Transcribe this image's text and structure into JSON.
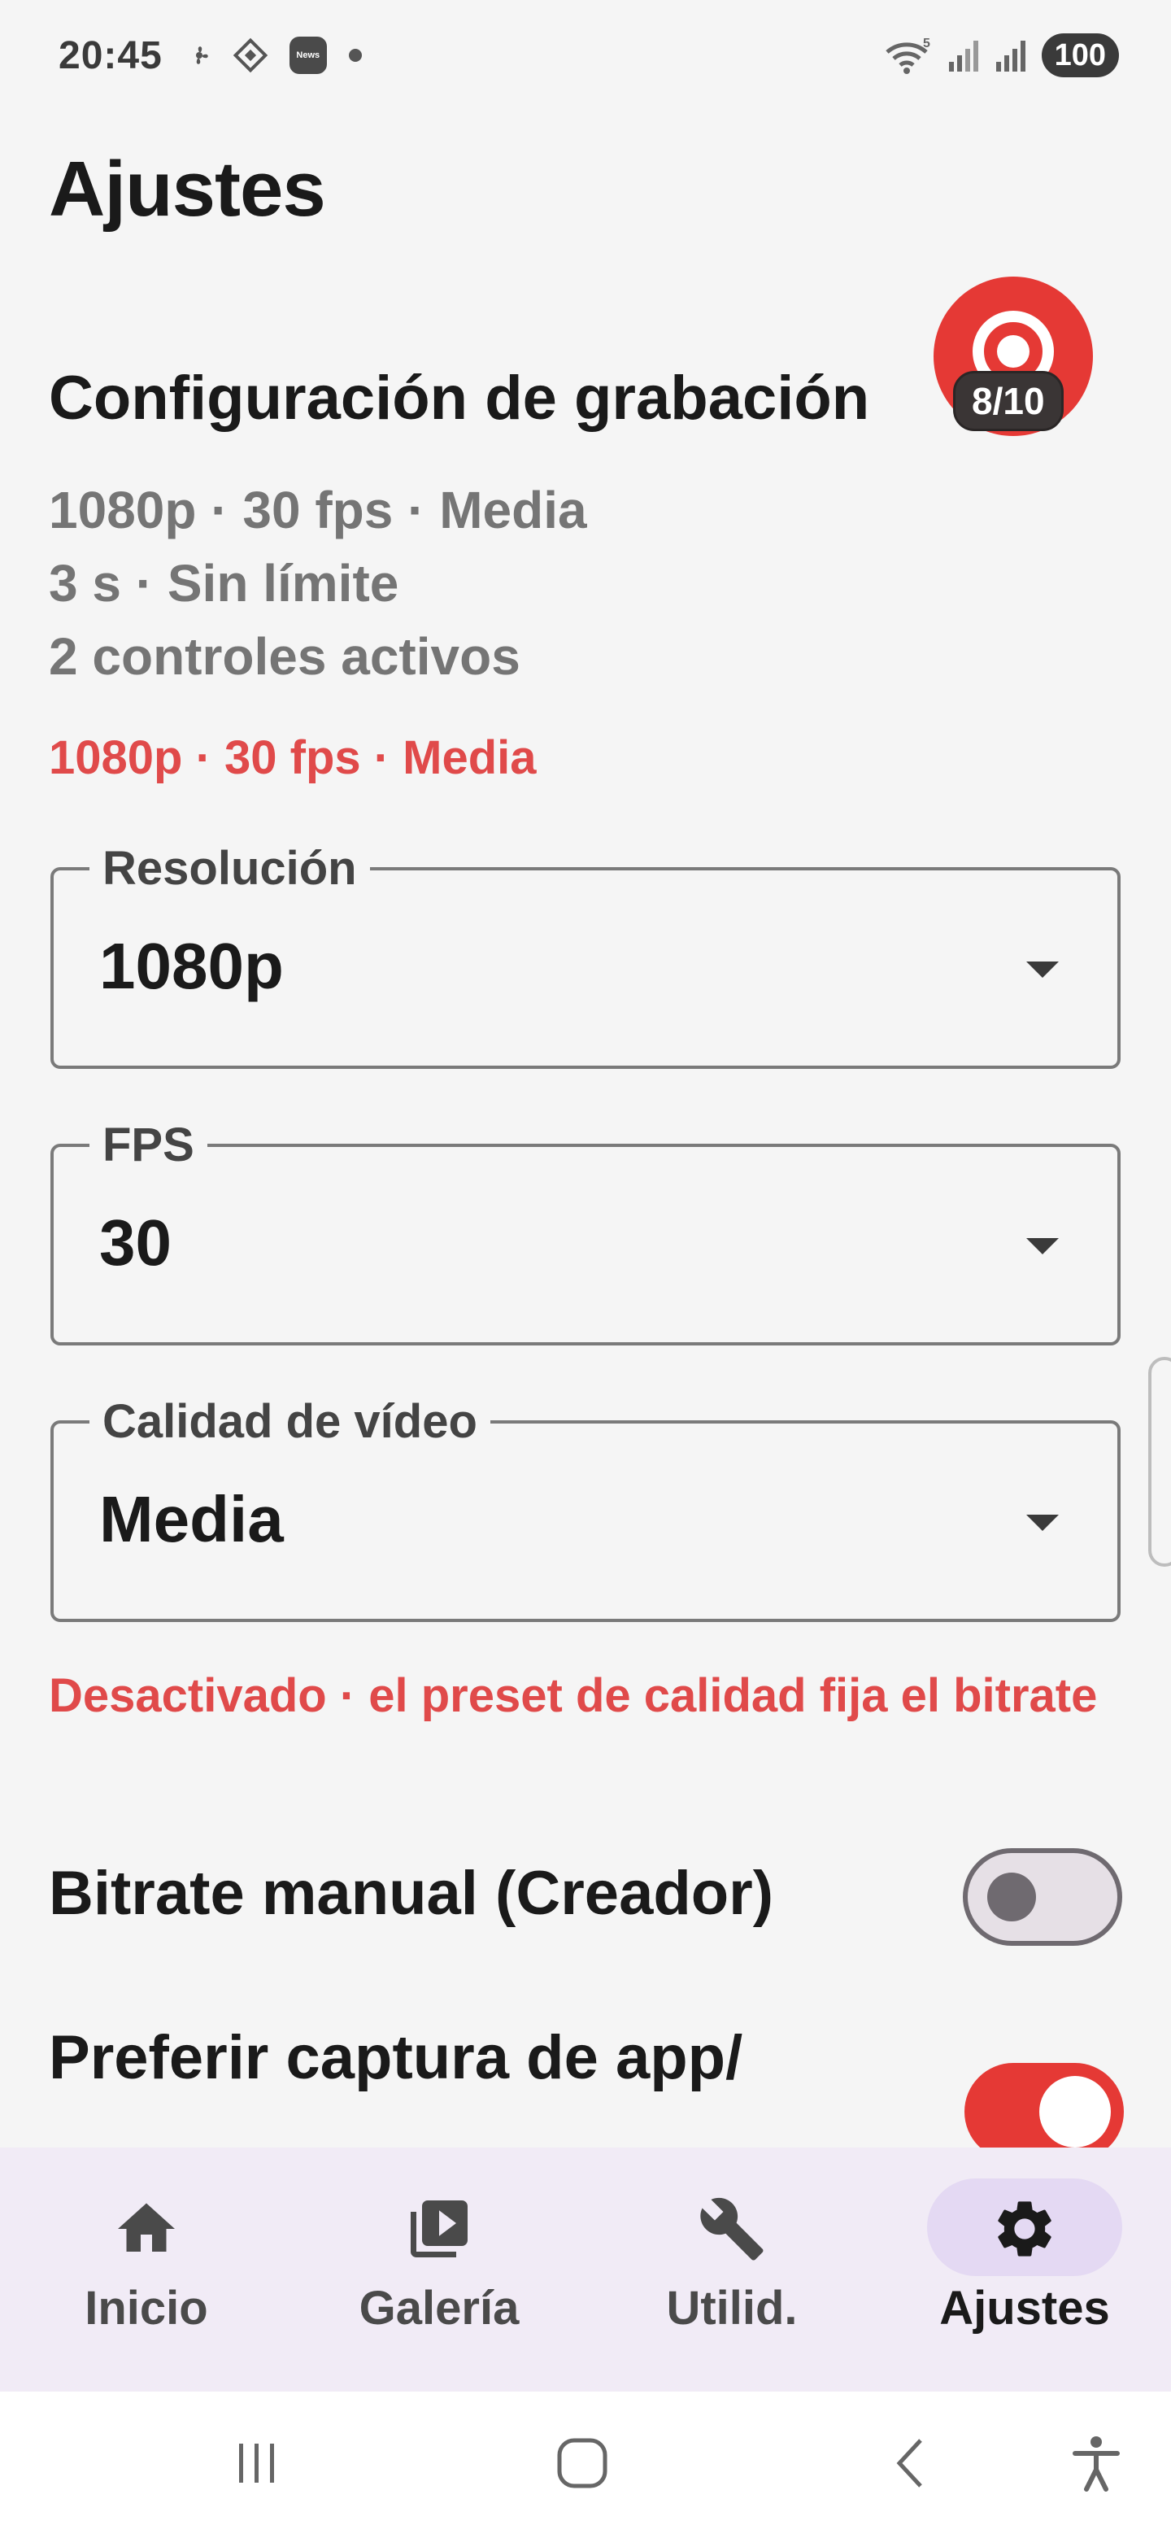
{
  "status_bar": {
    "time": "20:45",
    "notification_icons": [
      "fan-icon",
      "app-diamond-icon",
      "news-icon",
      "dot-icon"
    ],
    "news_badge": "News",
    "signal_icons": [
      "wifi-5-icon",
      "signal-1-icon",
      "signal-2-icon"
    ],
    "wifi_label": "5",
    "battery": "100"
  },
  "page": {
    "title": "Ajustes"
  },
  "recording": {
    "section_title": "Configuración de grabación",
    "summary_lines": [
      "1080p · 30 fps · Media",
      "3 s · Sin límite",
      "2 controles activos"
    ],
    "active_summary": "1080p · 30 fps · Media",
    "fab_counter": "8/10"
  },
  "fields": {
    "resolution": {
      "label": "Resolución",
      "value": "1080p"
    },
    "fps": {
      "label": "FPS",
      "value": "30"
    },
    "quality": {
      "label": "Calidad de vídeo",
      "value": "Media"
    }
  },
  "bitrate_note": "Desactivado · el preset de calidad fija el bitrate",
  "toggles": {
    "manual_bitrate": {
      "label": "Bitrate manual (Creador)",
      "on": false
    },
    "prefer_capture": {
      "label": "Preferir captura de app/",
      "on": true
    }
  },
  "bottom_nav": {
    "items": [
      {
        "label": "Inicio",
        "icon": "home-icon"
      },
      {
        "label": "Galería",
        "icon": "video-library-icon"
      },
      {
        "label": "Utilid.",
        "icon": "wrench-icon"
      },
      {
        "label": "Ajustes",
        "icon": "gear-icon",
        "active": true
      }
    ]
  },
  "system_nav": [
    "recents-icon",
    "home-circle-icon",
    "back-icon",
    "accessibility-icon"
  ],
  "colors": {
    "accent": "#e53935",
    "accent_text": "#e04a4a",
    "nav_background": "#f1ebf6",
    "nav_active_pill": "#e4d9f3"
  }
}
